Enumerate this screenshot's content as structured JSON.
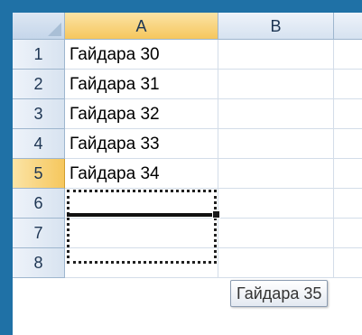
{
  "columns": [
    "A",
    "B"
  ],
  "active_column": "A",
  "rows": [
    {
      "num": "1",
      "a": "Гайдара 30",
      "b": ""
    },
    {
      "num": "2",
      "a": "Гайдара 31",
      "b": ""
    },
    {
      "num": "3",
      "a": "Гайдара 32",
      "b": ""
    },
    {
      "num": "4",
      "a": "Гайдара 33",
      "b": ""
    },
    {
      "num": "5",
      "a": "Гайдара 34",
      "b": ""
    },
    {
      "num": "6",
      "a": "",
      "b": ""
    },
    {
      "num": "7",
      "a": "",
      "b": ""
    },
    {
      "num": "8",
      "a": "",
      "b": ""
    }
  ],
  "active_row": "5",
  "autofill_tooltip": "Гайдара 35",
  "colors": {
    "window_frame": "#1f71a6",
    "header_active": "#f6c75d",
    "header_bg": "#dde7f3",
    "gridline": "#d3dde9"
  }
}
